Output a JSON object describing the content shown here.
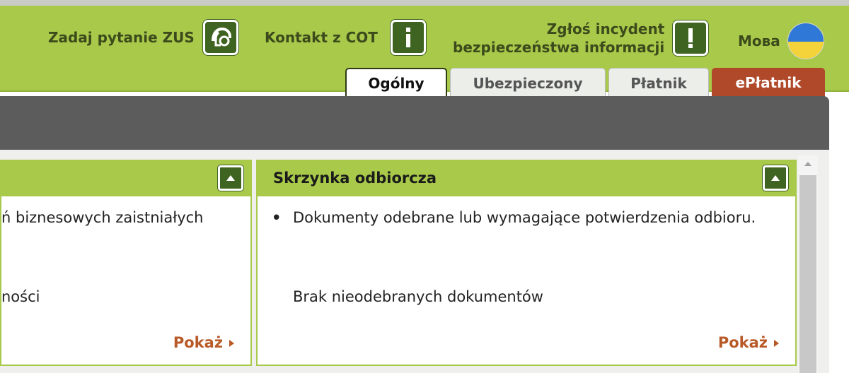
{
  "header": {
    "ask_zus_label": "Zadaj pytanie ZUS",
    "contact_label": "Kontakt z COT",
    "incident_label_line1": "Zgłoś incydent",
    "incident_label_line2": "bezpieczeństwa informacji",
    "language_label": "Мова",
    "icons": {
      "ask_zus": "headset-icon",
      "contact": "info-icon",
      "incident": "exclamation-icon",
      "language": "ukraine-flag-icon"
    }
  },
  "tabs": [
    {
      "label": "Ogólny",
      "active": true
    },
    {
      "label": "Ubezpieczony",
      "active": false
    },
    {
      "label": "Płatnik",
      "active": false
    },
    {
      "label": "ePłatnik",
      "active": false
    }
  ],
  "panels": {
    "left": {
      "line1": "ń biznesowych zaistniałych",
      "line2": "ności",
      "show_label": "Pokaż"
    },
    "right": {
      "title": "Skrzynka odbiorcza",
      "bullet": "Dokumenty odebrane lub wymagające potwierdzenia odbioru.",
      "empty_text": "Brak nieodebranych dokumentów",
      "show_label": "Pokaż"
    }
  },
  "colors": {
    "header_green": "#a8c94a",
    "icon_dark_green": "#3f6321",
    "eplatnik_tab": "#b0482a",
    "show_link": "#b85a28",
    "gray_bar": "#5c5c5c"
  }
}
